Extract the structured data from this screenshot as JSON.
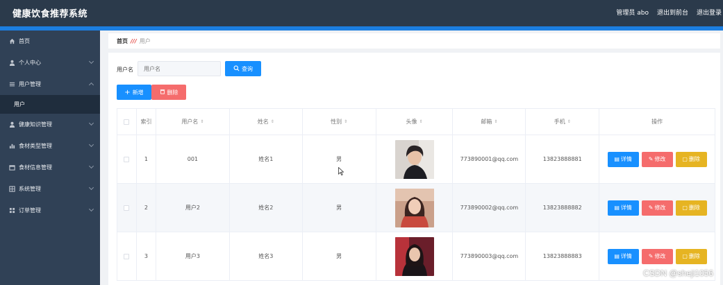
{
  "app": {
    "title": "健康饮食推荐系统",
    "admin_label": "管理员 abo",
    "back_to_front": "退出到前台",
    "logout": "退出登录"
  },
  "colors": {
    "topbar": "#2b3a4b",
    "accent": "#1c7ee0",
    "sidebar": "#304156",
    "primary": "#1890ff",
    "danger": "#f56c6c",
    "warning": "#e6b422"
  },
  "sidebar": {
    "items": [
      {
        "label": "首页",
        "icon": "home-icon",
        "expandable": false
      },
      {
        "label": "个人中心",
        "icon": "user-icon",
        "expandable": true
      },
      {
        "label": "用户管理",
        "icon": "list-icon",
        "expandable": true
      },
      {
        "label": "用户",
        "icon": "",
        "sub": true
      },
      {
        "label": "健康知识管理",
        "icon": "user-icon",
        "expandable": true
      },
      {
        "label": "食材类型管理",
        "icon": "bar-chart-icon",
        "expandable": true
      },
      {
        "label": "食材信息管理",
        "icon": "calendar-icon",
        "expandable": true
      },
      {
        "label": "系统管理",
        "icon": "grid-icon",
        "expandable": true
      },
      {
        "label": "订单管理",
        "icon": "apps-icon",
        "expandable": true
      }
    ]
  },
  "breadcrumb": {
    "home": "首页",
    "separator": "///",
    "current": "用户"
  },
  "search": {
    "label": "用户名",
    "placeholder": "用户名",
    "button": "查询"
  },
  "toolbar": {
    "add": "新增",
    "delete": "删除"
  },
  "table": {
    "headers": {
      "index": "索引",
      "username": "用户名",
      "name": "姓名",
      "gender": "性别",
      "avatar": "头像",
      "email": "邮箱",
      "phone": "手机",
      "actions": "操作"
    },
    "actions": {
      "detail": "详情",
      "edit": "修改",
      "remove": "删除"
    },
    "rows": [
      {
        "index": "1",
        "username": "001",
        "name": "姓名1",
        "gender": "男",
        "email": "773890001@qq.com",
        "phone": "13823888881"
      },
      {
        "index": "2",
        "username": "用户2",
        "name": "姓名2",
        "gender": "男",
        "email": "773890002@qq.com",
        "phone": "13823888882"
      },
      {
        "index": "3",
        "username": "用户3",
        "name": "姓名3",
        "gender": "男",
        "email": "773890003@qq.com",
        "phone": "13823888883"
      }
    ]
  },
  "watermark": "CSDN @sheji1056"
}
